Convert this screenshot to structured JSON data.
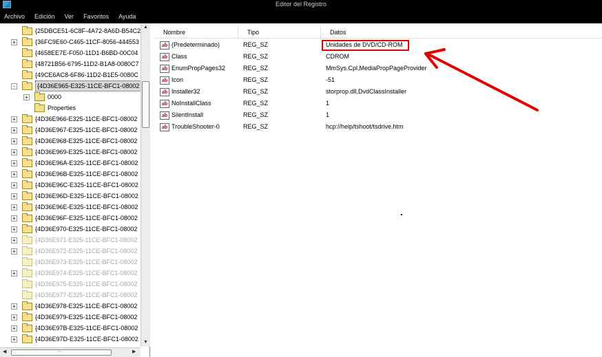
{
  "window": {
    "title": "Editor del Registro"
  },
  "menu": [
    "Archivo",
    "Edición",
    "Ver",
    "Favoritos",
    "Ayuda"
  ],
  "tree": [
    {
      "label": "{25DBCE51-6C8F-4A72-8A6D-B54C2",
      "indent": 0,
      "expander": "",
      "dim": false,
      "selected": false
    },
    {
      "label": "{36FC9E60-C465-11CF-8056-444553",
      "indent": 0,
      "expander": "+",
      "dim": false,
      "selected": false
    },
    {
      "label": "{4658EE7E-F050-11D1-B6BD-00C04",
      "indent": 0,
      "expander": "",
      "dim": false,
      "selected": false
    },
    {
      "label": "{48721B56-6795-11D2-B1A8-0080C7",
      "indent": 0,
      "expander": "",
      "dim": false,
      "selected": false
    },
    {
      "label": "{49CE6AC8-6F86-11D2-B1E5-0080C",
      "indent": 0,
      "expander": "",
      "dim": false,
      "selected": false
    },
    {
      "label": "{4D36E965-E325-11CE-BFC1-08002",
      "indent": 0,
      "expander": "-",
      "dim": false,
      "selected": true
    },
    {
      "label": "0000",
      "indent": 1,
      "expander": "+",
      "dim": false,
      "selected": false
    },
    {
      "label": "Properties",
      "indent": 1,
      "expander": "",
      "dim": false,
      "selected": false
    },
    {
      "label": "{4D36E966-E325-11CE-BFC1-08002",
      "indent": 0,
      "expander": "+",
      "dim": false,
      "selected": false
    },
    {
      "label": "{4D36E967-E325-11CE-BFC1-08002",
      "indent": 0,
      "expander": "+",
      "dim": false,
      "selected": false
    },
    {
      "label": "{4D36E968-E325-11CE-BFC1-08002",
      "indent": 0,
      "expander": "+",
      "dim": false,
      "selected": false
    },
    {
      "label": "{4D36E969-E325-11CE-BFC1-08002",
      "indent": 0,
      "expander": "+",
      "dim": false,
      "selected": false
    },
    {
      "label": "{4D36E96A-E325-11CE-BFC1-08002",
      "indent": 0,
      "expander": "+",
      "dim": false,
      "selected": false
    },
    {
      "label": "{4D36E96B-E325-11CE-BFC1-08002",
      "indent": 0,
      "expander": "+",
      "dim": false,
      "selected": false
    },
    {
      "label": "{4D36E96C-E325-11CE-BFC1-08002",
      "indent": 0,
      "expander": "+",
      "dim": false,
      "selected": false
    },
    {
      "label": "{4D36E96D-E325-11CE-BFC1-08002",
      "indent": 0,
      "expander": "+",
      "dim": false,
      "selected": false
    },
    {
      "label": "{4D36E96E-E325-11CE-BFC1-08002",
      "indent": 0,
      "expander": "+",
      "dim": false,
      "selected": false
    },
    {
      "label": "{4D36E96F-E325-11CE-BFC1-08002",
      "indent": 0,
      "expander": "+",
      "dim": false,
      "selected": false
    },
    {
      "label": "{4D36E970-E325-11CE-BFC1-08002",
      "indent": 0,
      "expander": "+",
      "dim": false,
      "selected": false
    },
    {
      "label": "{4D36E971-E325-11CE-BFC1-08002",
      "indent": 0,
      "expander": "+",
      "dim": true,
      "selected": false
    },
    {
      "label": "{4D36E972-E325-11CE-BFC1-08002",
      "indent": 0,
      "expander": "+",
      "dim": true,
      "selected": false
    },
    {
      "label": "{4D36E973-E325-11CE-BFC1-08002",
      "indent": 0,
      "expander": "",
      "dim": true,
      "selected": false
    },
    {
      "label": "{4D36E974-E325-11CE-BFC1-08002",
      "indent": 0,
      "expander": "+",
      "dim": true,
      "selected": false
    },
    {
      "label": "{4D36E975-E325-11CE-BFC1-08002",
      "indent": 0,
      "expander": "",
      "dim": true,
      "selected": false
    },
    {
      "label": "{4D36E977-E325-11CE-BFC1-08002",
      "indent": 0,
      "expander": "",
      "dim": true,
      "selected": false
    },
    {
      "label": "{4D36E978-E325-11CE-BFC1-08002",
      "indent": 0,
      "expander": "+",
      "dim": false,
      "selected": false
    },
    {
      "label": "{4D36E979-E325-11CE-BFC1-08002",
      "indent": 0,
      "expander": "+",
      "dim": false,
      "selected": false
    },
    {
      "label": "{4D36E97B-E325-11CE-BFC1-08002",
      "indent": 0,
      "expander": "+",
      "dim": false,
      "selected": false
    },
    {
      "label": "{4D36E97D-E325-11CE-BFC1-08002",
      "indent": 0,
      "expander": "+",
      "dim": false,
      "selected": false
    }
  ],
  "list": {
    "columns": [
      "Nombre",
      "Tipo",
      "Datos"
    ],
    "rows": [
      {
        "name": "(Predeterminado)",
        "type": "REG_SZ",
        "data": "Unidades de DVD/CD-ROM"
      },
      {
        "name": "Class",
        "type": "REG_SZ",
        "data": "CDROM"
      },
      {
        "name": "EnumPropPages32",
        "type": "REG_SZ",
        "data": "MmSys.Cpl,MediaPropPageProvider"
      },
      {
        "name": "Icon",
        "type": "REG_SZ",
        "data": "-51"
      },
      {
        "name": "Installer32",
        "type": "REG_SZ",
        "data": "storprop.dll,DvdClassInstaller"
      },
      {
        "name": "NoInstallClass",
        "type": "REG_SZ",
        "data": "1"
      },
      {
        "name": "SilentInstall",
        "type": "REG_SZ",
        "data": "1"
      },
      {
        "name": "TroubleShooter-0",
        "type": "REG_SZ",
        "data": "hcp://help/tshoot/tsdrive.htm"
      }
    ]
  },
  "annotation": {
    "color": "#e00000",
    "icons": [
      "registry-icon",
      "folder-icon",
      "string-value-icon",
      "red-arrow"
    ]
  }
}
